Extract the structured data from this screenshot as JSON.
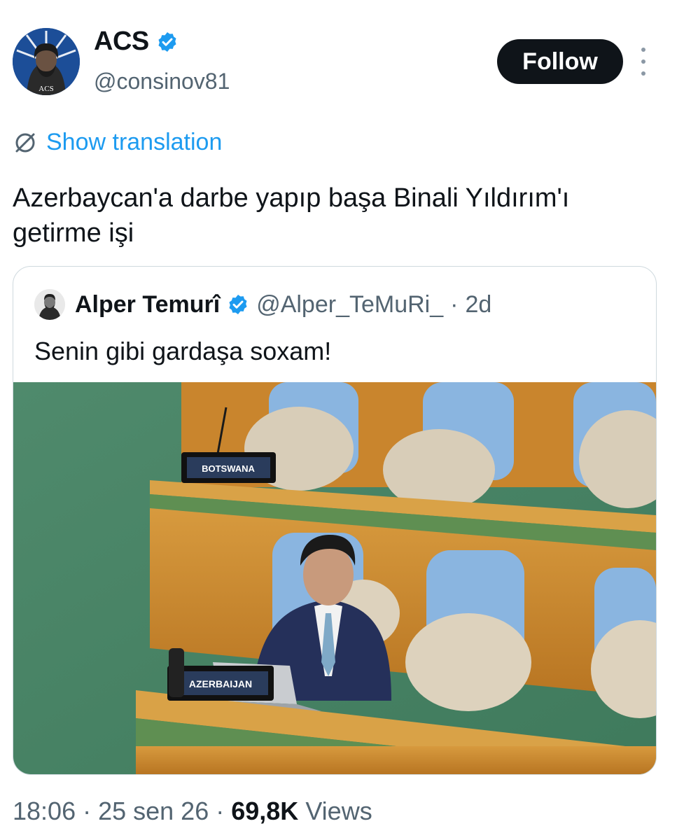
{
  "author": {
    "display_name": "ACS",
    "handle": "@consinov81",
    "avatar_text": "ACS"
  },
  "actions": {
    "follow_label": "Follow"
  },
  "translation": {
    "label": "Show translation"
  },
  "tweet": {
    "text": "Azerbaycan'a darbe yapıp başa Binali Yıldırım'ı getirme işi"
  },
  "quote": {
    "author_name": "Alper Temurî",
    "handle": "@Alper_TeMuRi_",
    "separator": "·",
    "age": "2d",
    "text": "Senin gibi gardaşa soxam!",
    "media": {
      "placard_1": "BOTSWANA",
      "placard_2": "AZERBAIJAN"
    }
  },
  "meta": {
    "time": "18:06",
    "date": "25 sen 26",
    "views_count": "69,8K",
    "views_label": "Views",
    "dot": "·"
  },
  "colors": {
    "accent": "#1d9bf0",
    "text": "#0f1419",
    "muted": "#536471",
    "follow_bg": "#0f1419",
    "verified": "#1d9bf0"
  }
}
